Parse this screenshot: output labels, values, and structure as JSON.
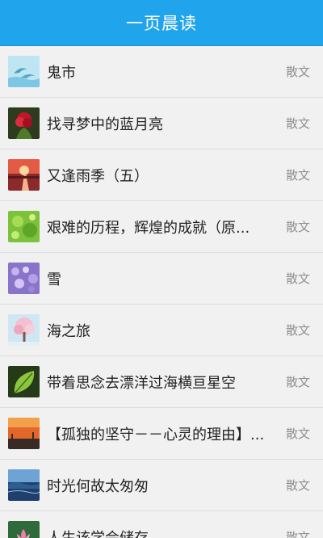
{
  "header": {
    "title": "一页晨读"
  },
  "items": [
    {
      "title": "鬼市",
      "category": "散文",
      "thumb_icon": "dolphin-thumbnail"
    },
    {
      "title": "找寻梦中的蓝月亮",
      "category": "散文",
      "thumb_icon": "red-flower-thumbnail"
    },
    {
      "title": "又逢雨季（五）",
      "category": "散文",
      "thumb_icon": "sunset-road-thumbnail"
    },
    {
      "title": "艰难的历程，辉煌的成就（原...",
      "category": "散文",
      "thumb_icon": "green-leaves-thumbnail"
    },
    {
      "title": "雪",
      "category": "散文",
      "thumb_icon": "purple-flowers-thumbnail"
    },
    {
      "title": "海之旅",
      "category": "散文",
      "thumb_icon": "pink-tree-thumbnail"
    },
    {
      "title": "带着思念去漂洋过海横亘星空",
      "category": "散文",
      "thumb_icon": "green-leaf-thumbnail"
    },
    {
      "title": "【孤独的坚守－－心灵的理由】...",
      "category": "散文",
      "thumb_icon": "orange-dusk-thumbnail"
    },
    {
      "title": "时光何故太匆匆",
      "category": "散文",
      "thumb_icon": "blue-sea-thumbnail"
    },
    {
      "title": "人生该学会储存",
      "category": "散文",
      "thumb_icon": "lotus-thumbnail"
    }
  ],
  "colors": {
    "header_bg": "#20a4eb",
    "header_text": "#ffffff",
    "list_bg": "#f1f1f1",
    "title_text": "#222222",
    "category_text": "#8f8f8f",
    "divider": "#dcdcdc"
  }
}
